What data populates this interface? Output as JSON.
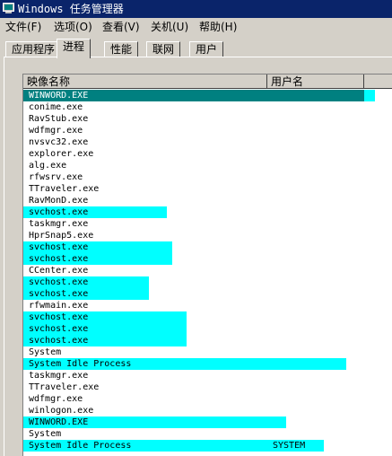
{
  "window": {
    "title": "Windows 任务管理器",
    "title_icon": "task-manager-icon"
  },
  "menu": [
    "文件(F)",
    "选项(O)",
    "查看(V)",
    "关机(U)",
    "帮助(H)"
  ],
  "tabs": [
    "应用程序",
    "进程",
    "性能",
    "联网",
    "用户"
  ],
  "active_tab": "进程",
  "columns": {
    "image_name": "映像名称",
    "user_name": "用户名"
  },
  "colors": {
    "highlight": "#00ffff",
    "selected": "#008080",
    "titlebar": "#0a246a"
  },
  "processes": [
    {
      "name": "WINWORD.EXE",
      "user": "",
      "highlight": "selected"
    },
    {
      "name": "conime.exe",
      "user": "",
      "highlight": ""
    },
    {
      "name": "RavStub.exe",
      "user": "",
      "highlight": ""
    },
    {
      "name": "wdfmgr.exe",
      "user": "",
      "highlight": ""
    },
    {
      "name": "nvsvc32.exe",
      "user": "",
      "highlight": ""
    },
    {
      "name": "explorer.exe",
      "user": "",
      "highlight": ""
    },
    {
      "name": "alg.exe",
      "user": "",
      "highlight": ""
    },
    {
      "name": "rfwsrv.exe",
      "user": "",
      "highlight": ""
    },
    {
      "name": "TTraveler.exe",
      "user": "",
      "highlight": ""
    },
    {
      "name": "RavMonD.exe",
      "user": "",
      "highlight": ""
    },
    {
      "name": "svchost.exe",
      "user": "",
      "highlight": "cyan"
    },
    {
      "name": "taskmgr.exe",
      "user": "",
      "highlight": ""
    },
    {
      "name": "HprSnap5.exe",
      "user": "",
      "highlight": ""
    },
    {
      "name": "svchost.exe",
      "user": "",
      "highlight": "cyan"
    },
    {
      "name": "svchost.exe",
      "user": "",
      "highlight": "cyan"
    },
    {
      "name": "CCenter.exe",
      "user": "",
      "highlight": ""
    },
    {
      "name": "svchost.exe",
      "user": "",
      "highlight": "cyan"
    },
    {
      "name": "svchost.exe",
      "user": "",
      "highlight": "cyan"
    },
    {
      "name": "rfwmain.exe",
      "user": "",
      "highlight": ""
    },
    {
      "name": "svchost.exe",
      "user": "",
      "highlight": "cyan"
    },
    {
      "name": "svchost.exe",
      "user": "",
      "highlight": "cyan"
    },
    {
      "name": "svchost.exe",
      "user": "",
      "highlight": "cyan"
    },
    {
      "name": "System",
      "user": "",
      "highlight": ""
    },
    {
      "name": "System Idle Process",
      "user": "",
      "highlight": "cyan"
    },
    {
      "name": "taskmgr.exe",
      "user": "",
      "highlight": ""
    },
    {
      "name": "TTraveler.exe",
      "user": "",
      "highlight": ""
    },
    {
      "name": "wdfmgr.exe",
      "user": "",
      "highlight": ""
    },
    {
      "name": "winlogon.exe",
      "user": "",
      "highlight": ""
    },
    {
      "name": "WINWORD.EXE",
      "user": "",
      "highlight": "cyan"
    },
    {
      "name": "System",
      "user": "",
      "highlight": ""
    },
    {
      "name": "System Idle Process",
      "user": "SYSTEM",
      "highlight": "cyan"
    }
  ]
}
